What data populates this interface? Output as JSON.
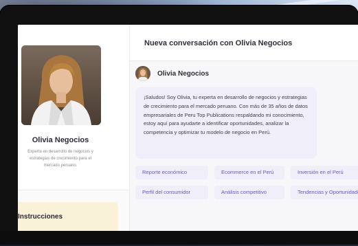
{
  "header": {
    "title": "Nueva conversación con Olivia Negocios"
  },
  "sidebar": {
    "agent_name": "Olivia Negocios",
    "agent_description_lines": [
      "Experta en desarrollo de negocios y",
      "estrategias de crecimiento para el",
      "mercado peruano."
    ],
    "instructions_title": "Instrucciones"
  },
  "message": {
    "author": "Olivia Negocios",
    "text": "¡Saludos! Soy Olivia, tu experta en desarrollo de negocios y estrategias de crecimiento para el mercado peruano. Con más de 35 años de datos empresariales de Peru Top Publications respaldando mi conocimiento, estoy aquí para ayudarte a identificar oportunidades, analizar la competencia y optimizar tu modelo de negocio en Perú."
  },
  "suggestions": [
    "Reporte económico",
    "Ecommerce en el Perú",
    "Inversión en el Perú",
    "Perfil del consumidor",
    "Análisis competitivo",
    "Tendencias y Oportunidades"
  ]
}
